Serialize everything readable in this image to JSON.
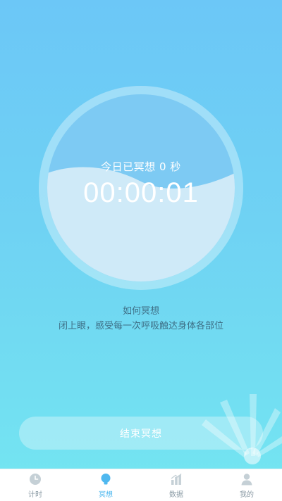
{
  "status": {
    "today_prefix": "今日已冥想",
    "today_value": "0",
    "today_unit": "秒",
    "timer": "00:00:01"
  },
  "guide": {
    "title": "如何冥想",
    "description": "闭上眼，感受每一次呼吸触达身体各部位"
  },
  "actions": {
    "end_label": "结束冥想"
  },
  "tabs": [
    {
      "label": "计时",
      "icon": "clock-icon",
      "active": false
    },
    {
      "label": "冥想",
      "icon": "bulb-icon",
      "active": true
    },
    {
      "label": "数据",
      "icon": "bar-chart-icon",
      "active": false
    },
    {
      "label": "我的",
      "icon": "user-icon",
      "active": false
    }
  ],
  "colors": {
    "bg_top": "#6cc7f7",
    "bg_bottom": "#74e6f1",
    "accent": "#4fb8ef",
    "tab_inactive": "#8a9aa4"
  }
}
